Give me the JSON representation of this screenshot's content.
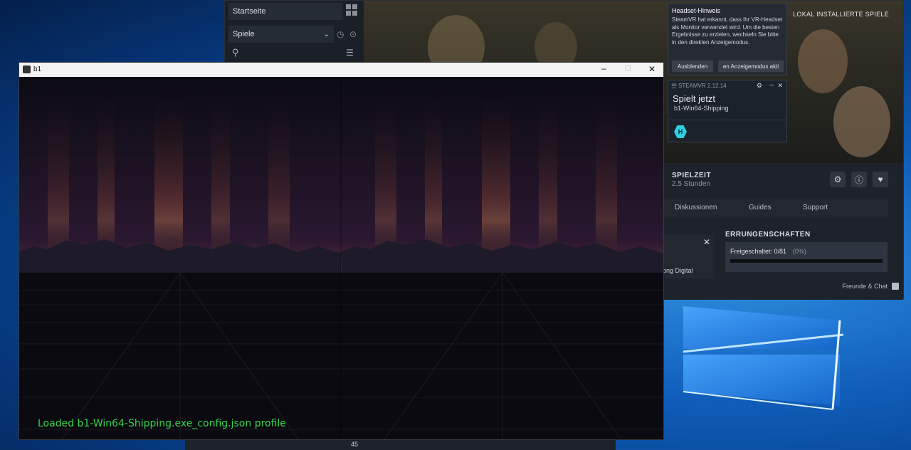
{
  "steam": {
    "sidebar": {
      "home_label": "Startseite",
      "filter_label": "Spiele"
    },
    "header": {
      "installed_games": "LOKAL INSTALLIERTE SPIELE"
    },
    "headset_notice": {
      "title": "Headset-Hinweis",
      "body": "SteamVR hat erkannt, dass Ihr VR-Headset als Monitor verwendet wird. Um die besten Ergebnisse zu erzielen, wechseln Sie bitte in den direkten Anzeigemodus.",
      "hide_button": "Ausblenden",
      "mode_button": "en Anzeigemodus akti"
    },
    "steamvr_panel": {
      "title": "STEAMVR 2.12.14",
      "playing_now": "Spielt jetzt",
      "game_name": "b1-Win64-Shipping"
    },
    "game_info": {
      "playtime_label": "SPIELZEIT",
      "playtime_value": "2,5 Stunden"
    },
    "tabs": [
      "Diskussionen",
      "Guides",
      "Support"
    ],
    "achievements": {
      "heading": "ERRUNGENSCHAFTEN",
      "unlocked_label": "Freigeschaltet: 0/81",
      "unlocked_percent": "(0%)",
      "progress": 0
    },
    "partial_text": "ong Digital",
    "friends_chat": "Freunde & Chat"
  },
  "game_window": {
    "title": "b1",
    "status_message": "Loaded b1-Win64-Shipping.exe_config.json profile"
  },
  "background_window": {
    "value": "45"
  },
  "colors": {
    "status_green": "#34d34a",
    "steam_bg": "#171a21",
    "accent_cyan": "#2fd0e0"
  }
}
